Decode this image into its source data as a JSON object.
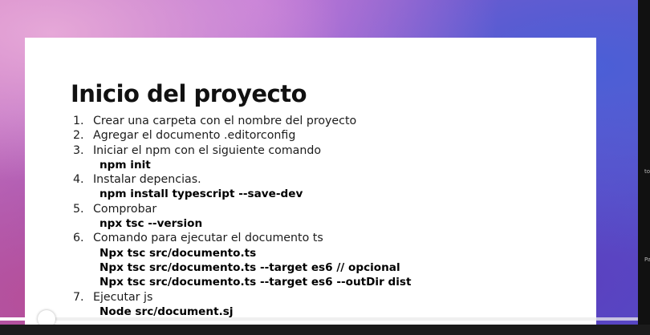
{
  "slide": {
    "title": "Inicio del proyecto",
    "steps": [
      {
        "number": "1.",
        "text": "Crear una carpeta con el nombre del proyecto",
        "commands": []
      },
      {
        "number": "2.",
        "text": "Agregar el documento .editorconfig",
        "commands": []
      },
      {
        "number": "3.",
        "text": "Iniciar el npm con el siguiente comando",
        "commands": [
          "npm init"
        ]
      },
      {
        "number": "4.",
        "text": "Instalar depencias.",
        "commands": [
          "npm install typescript --save-dev"
        ]
      },
      {
        "number": "5.",
        "text": "Comprobar",
        "commands": [
          "npx tsc --version"
        ]
      },
      {
        "number": "6.",
        "text": "Comando para ejecutar el documento ts",
        "commands": [
          "Npx tsc src/documento.ts",
          "Npx tsc src/documento.ts --target es6 // opcional",
          "Npx tsc src/documento.ts --target es6 --outDir dist"
        ]
      },
      {
        "number": "7.",
        "text": "Ejecutar js",
        "commands": [
          "Node src/document.sj"
        ]
      }
    ]
  },
  "player": {
    "progress_fraction": 0.072
  },
  "edge_text": [
    "to",
    "Pa"
  ],
  "colors": {
    "slide_background": "#ffffff",
    "text": "#111111",
    "progress_played": "#ffffff",
    "progress_track": "#ebebeb"
  }
}
